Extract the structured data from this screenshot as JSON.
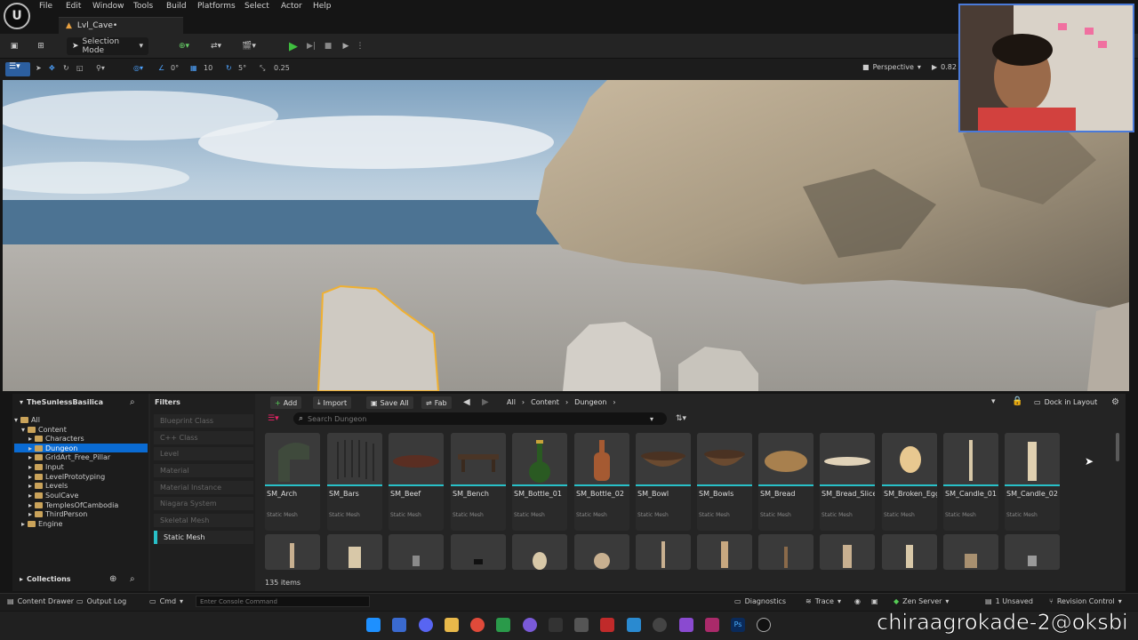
{
  "menu": [
    "File",
    "Edit",
    "Window",
    "Tools",
    "Build",
    "Platforms",
    "Select",
    "Actor",
    "Help"
  ],
  "document_tab": "Lvl_Cave•",
  "toolbar": {
    "mode": "Selection Mode"
  },
  "viewport_toolbar": {
    "rotate_snap_angle": "0°",
    "grid_snap": "10",
    "angle_snap": "5°",
    "scale_snap": "0.25",
    "perspective": "Perspective",
    "camera_speed": "0.82"
  },
  "content_browser": {
    "root": "TheSunlessBasilica",
    "tree": [
      "All",
      "Content",
      "Characters",
      "Dungeon",
      "GridArt_Free_Pillar",
      "Input",
      "LevelPrototyping",
      "Levels",
      "SoulCave",
      "TemplesOfCambodia",
      "ThirdPerson",
      "Engine"
    ],
    "filters_title": "Filters",
    "filters": [
      "Blueprint Class",
      "C++ Class",
      "Level",
      "Material",
      "Material Instance",
      "Niagara System",
      "Skeletal Mesh",
      "Static Mesh"
    ],
    "buttons": {
      "add": "Add",
      "import": "Import",
      "save_all": "Save All",
      "fab": "Fab"
    },
    "breadcrumb": [
      "All",
      "Content",
      "Dungeon"
    ],
    "search_placeholder": "Search Dungeon",
    "dock_label": "Dock in Layout",
    "assets": [
      "SM_Arch",
      "SM_Bars",
      "SM_Beef",
      "SM_Bench",
      "SM_Bottle_01",
      "SM_Bottle_02",
      "SM_Bowl",
      "SM_Bowls",
      "SM_Bread",
      "SM_Bread_Slice",
      "SM_Broken_Egg",
      "SM_Candle_01",
      "SM_Candle_02"
    ],
    "asset_type": "Static Mesh",
    "item_count": "135 items",
    "collections": "Collections"
  },
  "status": {
    "content_drawer": "Content Drawer",
    "output_log": "Output Log",
    "cmd": "Cmd",
    "console_placeholder": "Enter Console Command",
    "diagnostics": "Diagnostics",
    "trace": "Trace",
    "zen": "Zen Server",
    "unsaved": "1 Unsaved",
    "revision": "Revision Control"
  },
  "watermark": "chiraagrokade-2@oksbi",
  "colors": {
    "selected": "#0a6bd3",
    "accent_cyan": "#28c0c8",
    "folder": "#caa35a",
    "play_green": "#3fbf3f"
  }
}
